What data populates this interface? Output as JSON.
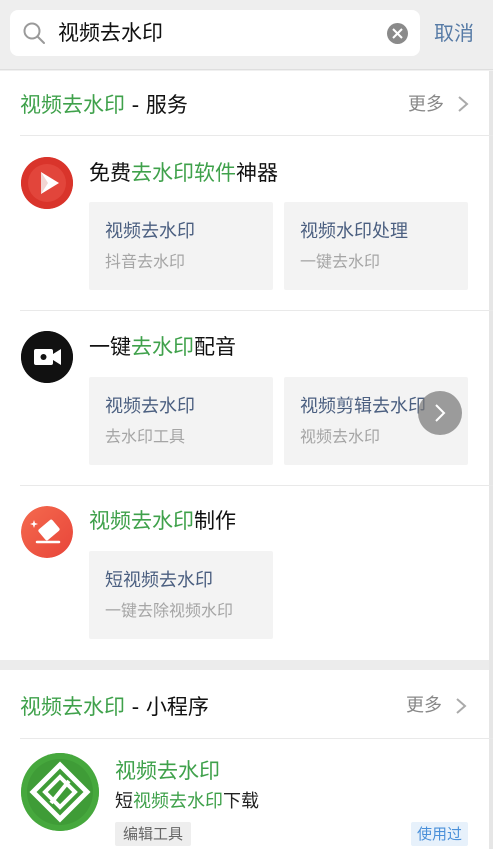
{
  "search": {
    "query": "视频去水印",
    "cancel_label": "取消"
  },
  "services": {
    "heading_keyword": "视频去水印",
    "heading_suffix": " - 服务",
    "more_label": "更多",
    "items": [
      {
        "title_pre": "免费",
        "title_hl": "去水印软件",
        "title_post": "神器",
        "tiles": [
          {
            "title": "视频去水印",
            "subtitle": "抖音去水印"
          },
          {
            "title": "视频水印处理",
            "subtitle": "一键去水印"
          }
        ]
      },
      {
        "title_pre": "一键",
        "title_hl": "去水印",
        "title_post": "配音",
        "tiles": [
          {
            "title": "视频去水印",
            "subtitle": "去水印工具"
          },
          {
            "title": "视频剪辑去水印",
            "subtitle": "视频去水印"
          }
        ]
      },
      {
        "title_pre": "",
        "title_hl": "视频去水印",
        "title_post": "制作",
        "tiles": [
          {
            "title": "短视频去水印",
            "subtitle": "一键去除视频水印"
          }
        ]
      }
    ]
  },
  "miniprogram": {
    "heading_keyword": "视频去水印",
    "heading_suffix": " - 小程序",
    "more_label": "更多",
    "title": "视频去水印",
    "desc_pre": "短",
    "desc_hl": "视频去水印",
    "desc_post": "下载",
    "tag": "编辑工具",
    "used_badge": "使用过"
  },
  "colors": {
    "highlight": "#3fa14b",
    "link": "#577ba6",
    "tile_title": "#4b5f80"
  }
}
